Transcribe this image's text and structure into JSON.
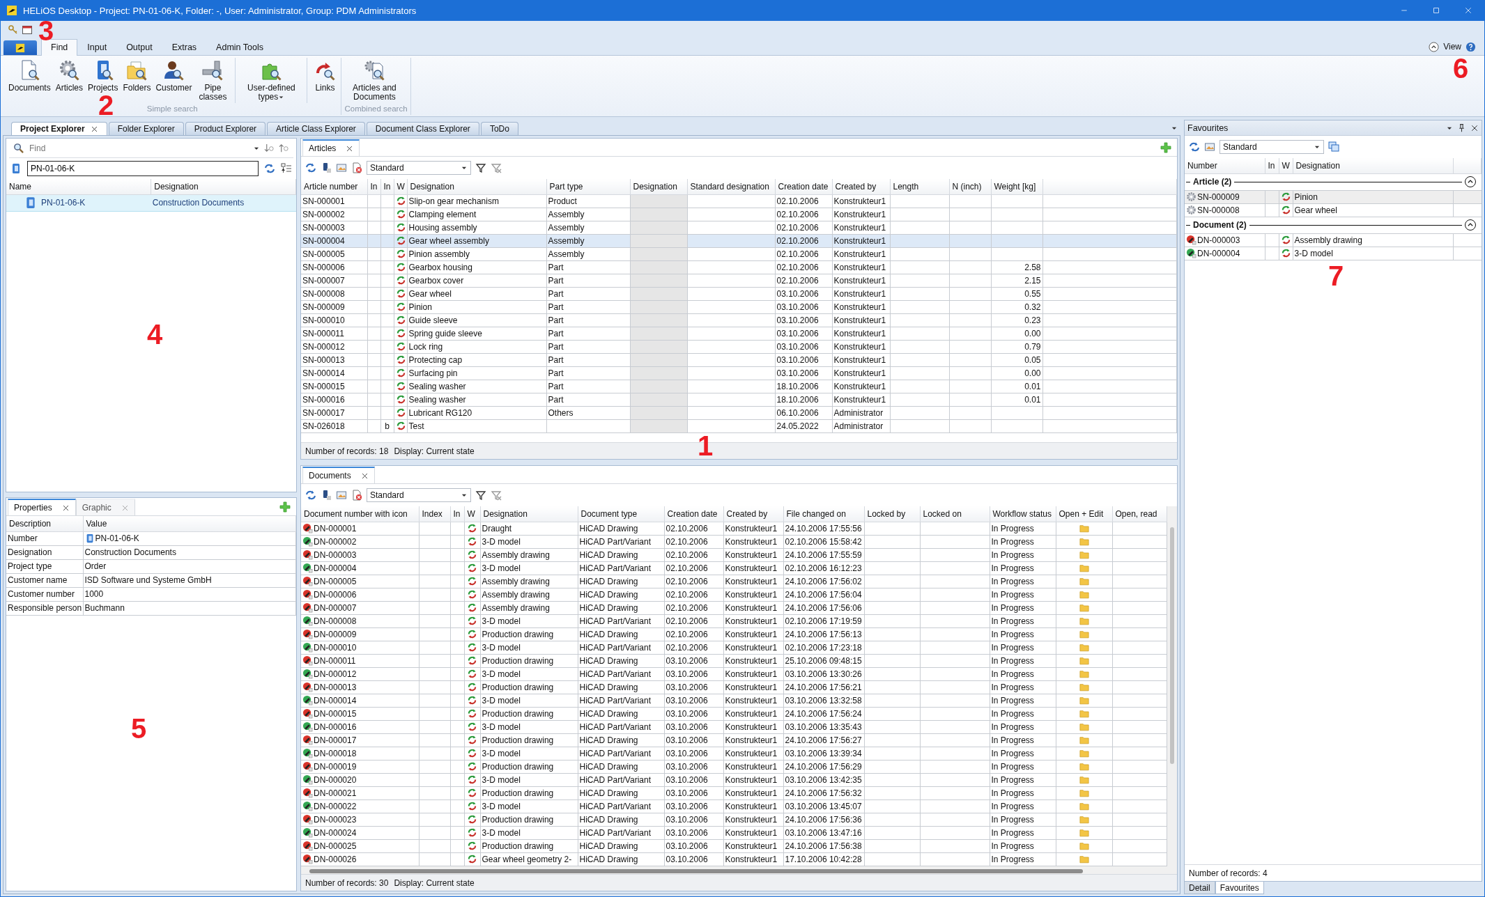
{
  "window": {
    "title": "HELiOS Desktop - Project: PN-01-06-K, Folder: -, User: Administrator, Group: PDM Administrators"
  },
  "ribbon": {
    "tabs": [
      {
        "label": "Find",
        "selected": true
      },
      {
        "label": "Input",
        "selected": false
      },
      {
        "label": "Output",
        "selected": false
      },
      {
        "label": "Extras",
        "selected": false
      },
      {
        "label": "Admin Tools",
        "selected": false
      }
    ],
    "view_label": "View",
    "groups": [
      {
        "label": "Simple search",
        "buttons": [
          {
            "label": "Documents"
          },
          {
            "label": "Articles"
          },
          {
            "label": "Projects"
          },
          {
            "label": "Folders"
          },
          {
            "label": "Customer"
          },
          {
            "label": "Pipe classes",
            "separator_after": true
          },
          {
            "label": "User-defined types",
            "dropdown": true,
            "separator_after": true
          },
          {
            "label": "Links"
          }
        ]
      },
      {
        "label": "Combined search",
        "buttons": [
          {
            "label": "Articles and Documents"
          }
        ]
      }
    ]
  },
  "explorer_tabs": [
    {
      "label": "Project Explorer",
      "selected": true
    },
    {
      "label": "Folder Explorer",
      "selected": false
    },
    {
      "label": "Product Explorer",
      "selected": false
    },
    {
      "label": "Article Class Explorer",
      "selected": false
    },
    {
      "label": "Document Class Explorer",
      "selected": false
    },
    {
      "label": "ToDo",
      "selected": false
    }
  ],
  "project_explorer": {
    "find": {
      "placeholder": "Find"
    },
    "project_field": {
      "value": "PN-01-06-K"
    },
    "columns": [
      "Name",
      "Designation"
    ],
    "rows": [
      {
        "name": "PN-01-06-K",
        "designation": "Construction Documents",
        "selected": true
      }
    ]
  },
  "properties": {
    "tabs": [
      {
        "label": "Properties",
        "selected": true
      },
      {
        "label": "Graphic",
        "selected": false
      }
    ],
    "columns": [
      "Description",
      "Value"
    ],
    "rows": [
      {
        "description": "Number",
        "value": "PN-01-06-K",
        "icon": true
      },
      {
        "description": "Designation",
        "value": "Construction Documents"
      },
      {
        "description": "Project type",
        "value": "Order"
      },
      {
        "description": "Customer name",
        "value": "ISD Software und Systeme GmbH"
      },
      {
        "description": "Customer number",
        "value": "1000"
      },
      {
        "description": "Responsible person",
        "value": "Buchmann"
      }
    ]
  },
  "articles": {
    "tab": "Articles",
    "view": "Standard",
    "columns": [
      "Article number",
      "In",
      "In",
      "W",
      "Designation",
      "Part type",
      "Designation",
      "Standard designation",
      "Creation date",
      "Created by",
      "Length",
      "N (inch)",
      "Weight [kg]"
    ],
    "rows": [
      {
        "number": "SN-000001",
        "designation": "Slip-on gear mechanism",
        "part_type": "Product",
        "created": "02.10.2006",
        "by": "Konstrukteur1",
        "selected": false
      },
      {
        "number": "SN-000002",
        "designation": "Clamping element",
        "part_type": "Assembly",
        "created": "02.10.2006",
        "by": "Konstrukteur1",
        "selected": false
      },
      {
        "number": "SN-000003",
        "designation": "Housing assembly",
        "part_type": "Assembly",
        "created": "02.10.2006",
        "by": "Konstrukteur1",
        "selected": false
      },
      {
        "number": "SN-000004",
        "designation": "Gear wheel assembly",
        "part_type": "Assembly",
        "created": "02.10.2006",
        "by": "Konstrukteur1",
        "selected": true
      },
      {
        "number": "SN-000005",
        "designation": "Pinion assembly",
        "part_type": "Assembly",
        "created": "02.10.2006",
        "by": "Konstrukteur1",
        "selected": false
      },
      {
        "number": "SN-000006",
        "designation": "Gearbox housing",
        "part_type": "Part",
        "created": "02.10.2006",
        "by": "Konstrukteur1",
        "weight": "2.58",
        "selected": false
      },
      {
        "number": "SN-000007",
        "designation": "Gearbox cover",
        "part_type": "Part",
        "created": "02.10.2006",
        "by": "Konstrukteur1",
        "weight": "2.15",
        "selected": false
      },
      {
        "number": "SN-000008",
        "designation": "Gear wheel",
        "part_type": "Part",
        "created": "03.10.2006",
        "by": "Konstrukteur1",
        "weight": "0.55",
        "selected": false
      },
      {
        "number": "SN-000009",
        "designation": "Pinion",
        "part_type": "Part",
        "created": "03.10.2006",
        "by": "Konstrukteur1",
        "weight": "0.32",
        "selected": false
      },
      {
        "number": "SN-000010",
        "designation": "Guide sleeve",
        "part_type": "Part",
        "created": "03.10.2006",
        "by": "Konstrukteur1",
        "weight": "0.23",
        "selected": false
      },
      {
        "number": "SN-000011",
        "designation": "Spring guide sleeve",
        "part_type": "Part",
        "created": "03.10.2006",
        "by": "Konstrukteur1",
        "weight": "0.00",
        "selected": false
      },
      {
        "number": "SN-000012",
        "designation": "Lock ring",
        "part_type": "Part",
        "created": "03.10.2006",
        "by": "Konstrukteur1",
        "weight": "0.79",
        "selected": false
      },
      {
        "number": "SN-000013",
        "designation": "Protecting cap",
        "part_type": "Part",
        "created": "03.10.2006",
        "by": "Konstrukteur1",
        "weight": "0.05",
        "selected": false
      },
      {
        "number": "SN-000014",
        "designation": "Surfacing pin",
        "part_type": "Part",
        "created": "03.10.2006",
        "by": "Konstrukteur1",
        "weight": "0.00",
        "selected": false
      },
      {
        "number": "SN-000015",
        "designation": "Sealing washer",
        "part_type": "Part",
        "created": "18.10.2006",
        "by": "Konstrukteur1",
        "weight": "0.01",
        "selected": false
      },
      {
        "number": "SN-000016",
        "designation": "Sealing washer",
        "part_type": "Part",
        "created": "18.10.2006",
        "by": "Konstrukteur1",
        "weight": "0.01",
        "selected": false
      },
      {
        "number": "SN-000017",
        "designation": "Lubricant RG120",
        "part_type": "Others",
        "created": "06.10.2006",
        "by": "Administrator",
        "selected": false
      },
      {
        "number": "SN-026018",
        "in": "b",
        "designation": "Test",
        "created": "24.05.2022",
        "by": "Administrator",
        "selected": false
      }
    ],
    "records": "Number of records: 18",
    "display": "Display: Current state"
  },
  "documents": {
    "tab": "Documents",
    "view": "Standard",
    "columns": [
      "Document number with icon",
      "Index",
      "In",
      "W",
      "Designation",
      "Document type",
      "Creation date",
      "Created by",
      "File changed on",
      "Locked by",
      "Locked on",
      "Workflow status",
      "Open + Edit",
      "Open, read"
    ],
    "rows": [
      {
        "number": "DN-000001",
        "kind": "drawing",
        "designation": "Draught",
        "type": "HiCAD Drawing",
        "created": "02.10.2006",
        "by": "Konstrukteur1",
        "changed": "24.10.2006 17:55:56",
        "status": "In Progress"
      },
      {
        "number": "DN-000002",
        "kind": "model",
        "designation": "3-D model",
        "type": "HiCAD Part/Variant",
        "created": "02.10.2006",
        "by": "Konstrukteur1",
        "changed": "02.10.2006 15:58:42",
        "status": "In Progress"
      },
      {
        "number": "DN-000003",
        "kind": "drawing",
        "designation": "Assembly drawing",
        "type": "HiCAD Drawing",
        "created": "02.10.2006",
        "by": "Konstrukteur1",
        "changed": "24.10.2006 17:55:59",
        "status": "In Progress"
      },
      {
        "number": "DN-000004",
        "kind": "model",
        "designation": "3-D model",
        "type": "HiCAD Part/Variant",
        "created": "02.10.2006",
        "by": "Konstrukteur1",
        "changed": "02.10.2006 16:12:23",
        "status": "In Progress"
      },
      {
        "number": "DN-000005",
        "kind": "drawing",
        "designation": "Assembly drawing",
        "type": "HiCAD Drawing",
        "created": "02.10.2006",
        "by": "Konstrukteur1",
        "changed": "24.10.2006 17:56:02",
        "status": "In Progress"
      },
      {
        "number": "DN-000006",
        "kind": "drawing",
        "designation": "Assembly drawing",
        "type": "HiCAD Drawing",
        "created": "02.10.2006",
        "by": "Konstrukteur1",
        "changed": "24.10.2006 17:56:04",
        "status": "In Progress"
      },
      {
        "number": "DN-000007",
        "kind": "drawing",
        "designation": "Assembly drawing",
        "type": "HiCAD Drawing",
        "created": "02.10.2006",
        "by": "Konstrukteur1",
        "changed": "24.10.2006 17:56:06",
        "status": "In Progress"
      },
      {
        "number": "DN-000008",
        "kind": "model",
        "designation": "3-D model",
        "type": "HiCAD Part/Variant",
        "created": "02.10.2006",
        "by": "Konstrukteur1",
        "changed": "02.10.2006 17:19:59",
        "status": "In Progress"
      },
      {
        "number": "DN-000009",
        "kind": "drawing",
        "designation": "Production drawing",
        "type": "HiCAD Drawing",
        "created": "02.10.2006",
        "by": "Konstrukteur1",
        "changed": "24.10.2006 17:56:13",
        "status": "In Progress"
      },
      {
        "number": "DN-000010",
        "kind": "model",
        "designation": "3-D model",
        "type": "HiCAD Part/Variant",
        "created": "02.10.2006",
        "by": "Konstrukteur1",
        "changed": "02.10.2006 17:23:18",
        "status": "In Progress"
      },
      {
        "number": "DN-000011",
        "kind": "drawing",
        "designation": "Production drawing",
        "type": "HiCAD Drawing",
        "created": "03.10.2006",
        "by": "Konstrukteur1",
        "changed": "25.10.2006 09:48:15",
        "status": "In Progress"
      },
      {
        "number": "DN-000012",
        "kind": "model",
        "designation": "3-D model",
        "type": "HiCAD Part/Variant",
        "created": "03.10.2006",
        "by": "Konstrukteur1",
        "changed": "03.10.2006 13:30:26",
        "status": "In Progress"
      },
      {
        "number": "DN-000013",
        "kind": "drawing",
        "designation": "Production drawing",
        "type": "HiCAD Drawing",
        "created": "03.10.2006",
        "by": "Konstrukteur1",
        "changed": "24.10.2006 17:56:21",
        "status": "In Progress"
      },
      {
        "number": "DN-000014",
        "kind": "model",
        "designation": "3-D model",
        "type": "HiCAD Part/Variant",
        "created": "03.10.2006",
        "by": "Konstrukteur1",
        "changed": "03.10.2006 13:32:58",
        "status": "In Progress"
      },
      {
        "number": "DN-000015",
        "kind": "drawing",
        "designation": "Production drawing",
        "type": "HiCAD Drawing",
        "created": "03.10.2006",
        "by": "Konstrukteur1",
        "changed": "24.10.2006 17:56:24",
        "status": "In Progress"
      },
      {
        "number": "DN-000016",
        "kind": "model",
        "designation": "3-D model",
        "type": "HiCAD Part/Variant",
        "created": "03.10.2006",
        "by": "Konstrukteur1",
        "changed": "03.10.2006 13:35:43",
        "status": "In Progress"
      },
      {
        "number": "DN-000017",
        "kind": "drawing",
        "designation": "Production drawing",
        "type": "HiCAD Drawing",
        "created": "03.10.2006",
        "by": "Konstrukteur1",
        "changed": "24.10.2006 17:56:27",
        "status": "In Progress"
      },
      {
        "number": "DN-000018",
        "kind": "model",
        "designation": "3-D model",
        "type": "HiCAD Part/Variant",
        "created": "03.10.2006",
        "by": "Konstrukteur1",
        "changed": "03.10.2006 13:39:34",
        "status": "In Progress"
      },
      {
        "number": "DN-000019",
        "kind": "drawing",
        "designation": "Production drawing",
        "type": "HiCAD Drawing",
        "created": "03.10.2006",
        "by": "Konstrukteur1",
        "changed": "24.10.2006 17:56:29",
        "status": "In Progress"
      },
      {
        "number": "DN-000020",
        "kind": "model",
        "designation": "3-D model",
        "type": "HiCAD Part/Variant",
        "created": "03.10.2006",
        "by": "Konstrukteur1",
        "changed": "03.10.2006 13:42:35",
        "status": "In Progress"
      },
      {
        "number": "DN-000021",
        "kind": "drawing",
        "designation": "Production drawing",
        "type": "HiCAD Drawing",
        "created": "03.10.2006",
        "by": "Konstrukteur1",
        "changed": "24.10.2006 17:56:32",
        "status": "In Progress"
      },
      {
        "number": "DN-000022",
        "kind": "model",
        "designation": "3-D model",
        "type": "HiCAD Part/Variant",
        "created": "03.10.2006",
        "by": "Konstrukteur1",
        "changed": "03.10.2006 13:45:07",
        "status": "In Progress"
      },
      {
        "number": "DN-000023",
        "kind": "drawing",
        "designation": "Production drawing",
        "type": "HiCAD Drawing",
        "created": "03.10.2006",
        "by": "Konstrukteur1",
        "changed": "24.10.2006 17:56:36",
        "status": "In Progress"
      },
      {
        "number": "DN-000024",
        "kind": "model",
        "designation": "3-D model",
        "type": "HiCAD Part/Variant",
        "created": "03.10.2006",
        "by": "Konstrukteur1",
        "changed": "03.10.2006 13:47:16",
        "status": "In Progress"
      },
      {
        "number": "DN-000025",
        "kind": "drawing",
        "designation": "Production drawing",
        "type": "HiCAD Drawing",
        "created": "03.10.2006",
        "by": "Konstrukteur1",
        "changed": "24.10.2006 17:56:38",
        "status": "In Progress"
      },
      {
        "number": "DN-000026",
        "kind": "drawing",
        "designation": "Gear wheel geometry 2-",
        "type": "HiCAD Drawing",
        "created": "03.10.2006",
        "by": "Konstrukteur1",
        "changed": "17.10.2006 10:42:28",
        "status": "In Progress"
      }
    ],
    "records": "Number of records: 30",
    "display": "Display: Current state"
  },
  "favourites": {
    "title": "Favourites",
    "view": "Standard",
    "columns": [
      "Number",
      "In",
      "W",
      "Designation"
    ],
    "groups": [
      {
        "label": "Article (2)",
        "expanded": true,
        "items": [
          {
            "number": "SN-000009",
            "kind": "article",
            "designation": "Pinion",
            "selected": true
          },
          {
            "number": "SN-000008",
            "kind": "article",
            "designation": "Gear wheel",
            "selected": false
          }
        ]
      },
      {
        "label": "Document (2)",
        "expanded": true,
        "items": [
          {
            "number": "DN-000003",
            "kind": "drawing",
            "designation": "Assembly drawing",
            "selected": false
          },
          {
            "number": "DN-000004",
            "kind": "model",
            "designation": "3-D model",
            "selected": false
          }
        ]
      }
    ],
    "records": "Number of records: 4",
    "bottom_tabs": [
      {
        "label": "Detail",
        "selected": false
      },
      {
        "label": "Favourites",
        "selected": true
      }
    ]
  },
  "callouts": [
    "1",
    "2",
    "3",
    "4",
    "5",
    "6",
    "7"
  ]
}
